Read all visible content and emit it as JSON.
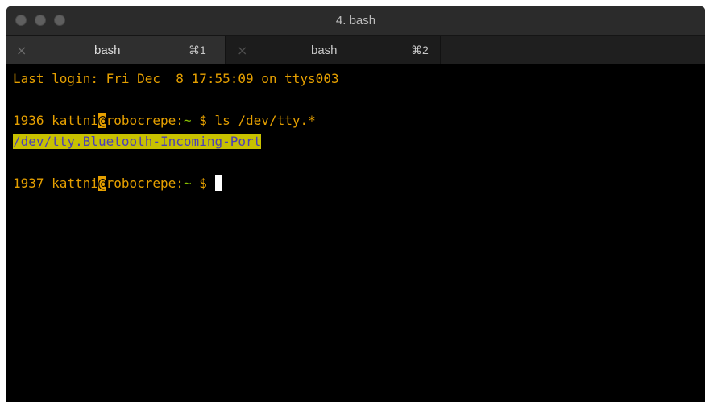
{
  "window": {
    "title": "4. bash"
  },
  "tabs": [
    {
      "label": "bash",
      "shortcut": "⌘1",
      "close": "×"
    },
    {
      "label": "bash",
      "shortcut": "⌘2",
      "close": "×"
    }
  ],
  "terminal": {
    "last_login": "Last login: Fri Dec  8 17:55:09 on ttys003",
    "prompt1": {
      "number": "1936",
      "user": "kattni",
      "at": "@",
      "host": "robocrepe:",
      "path": "~",
      "dollar": "$",
      "command": "ls /dev/tty.*"
    },
    "output": "/dev/tty.Bluetooth-Incoming-Port",
    "prompt2": {
      "number": "1937",
      "user": "kattni",
      "at": "@",
      "host": "robocrepe:",
      "path": "~",
      "dollar": "$"
    }
  },
  "colors": {
    "prompt": "#e6a000",
    "path": "#88c000",
    "highlight_bg": "#c8c100",
    "highlight_fg": "#4a3fb8",
    "background": "#000000"
  }
}
